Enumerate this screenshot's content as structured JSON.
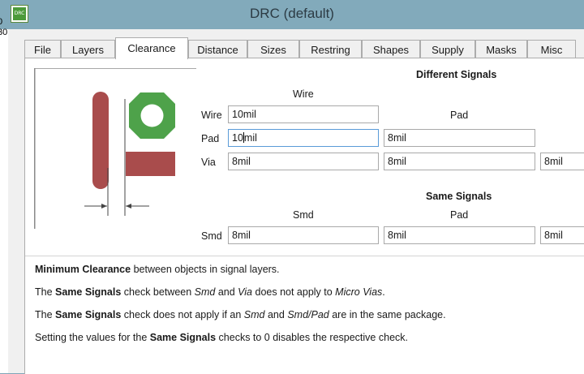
{
  "window": {
    "title": "DRC (default)",
    "app_icon": "eagle-drc-icon",
    "app_icon_text": "DRC",
    "left_strip": [
      "0",
      "30"
    ]
  },
  "tabs": [
    {
      "label": "File",
      "active": false
    },
    {
      "label": "Layers",
      "active": false
    },
    {
      "label": "Clearance",
      "active": true
    },
    {
      "label": "Distance",
      "active": false
    },
    {
      "label": "Sizes",
      "active": false
    },
    {
      "label": "Restring",
      "active": false
    },
    {
      "label": "Shapes",
      "active": false
    },
    {
      "label": "Supply",
      "active": false
    },
    {
      "label": "Masks",
      "active": false
    },
    {
      "label": "Misc",
      "active": false
    }
  ],
  "illustration": {
    "icon": "clearance-illustration-icon",
    "wire_color": "#a94c4c",
    "pad_color": "#4ea24a"
  },
  "different_signals": {
    "title": "Different Signals",
    "col_wire": "Wire",
    "col_pad": "Pad",
    "row_wire": "Wire",
    "row_pad": "Pad",
    "row_via": "Via",
    "wire_wire": "10mil",
    "pad_wire_before_caret": "10",
    "pad_wire_after_caret": "mil",
    "pad_pad": "8mil",
    "via_wire": "8mil",
    "via_pad": "8mil",
    "via_via": "8mil"
  },
  "same_signals": {
    "title": "Same Signals",
    "col_smd": "Smd",
    "col_pad": "Pad",
    "row_smd": "Smd",
    "smd_smd": "8mil",
    "smd_pad": "8mil",
    "smd_via": "8mil"
  },
  "info": {
    "line1_b": "Minimum Clearance",
    "line1_rest": " between objects in signal layers.",
    "line2_a": "The ",
    "line2_b": "Same Signals",
    "line2_c": " check between ",
    "line2_i1": "Smd",
    "line2_d": " and ",
    "line2_i2": "Via",
    "line2_e": " does not apply to ",
    "line2_i3": "Micro Vias",
    "line2_f": ".",
    "line3_a": "The ",
    "line3_b": "Same Signals",
    "line3_c": " check does not apply if an ",
    "line3_i1": "Smd",
    "line3_d": " and ",
    "line3_i2": "Smd/Pad",
    "line3_e": " are in the same package.",
    "line4_a": "Setting the values for the ",
    "line4_b": "Same Signals",
    "line4_c": " checks to 0 disables the respective check."
  }
}
